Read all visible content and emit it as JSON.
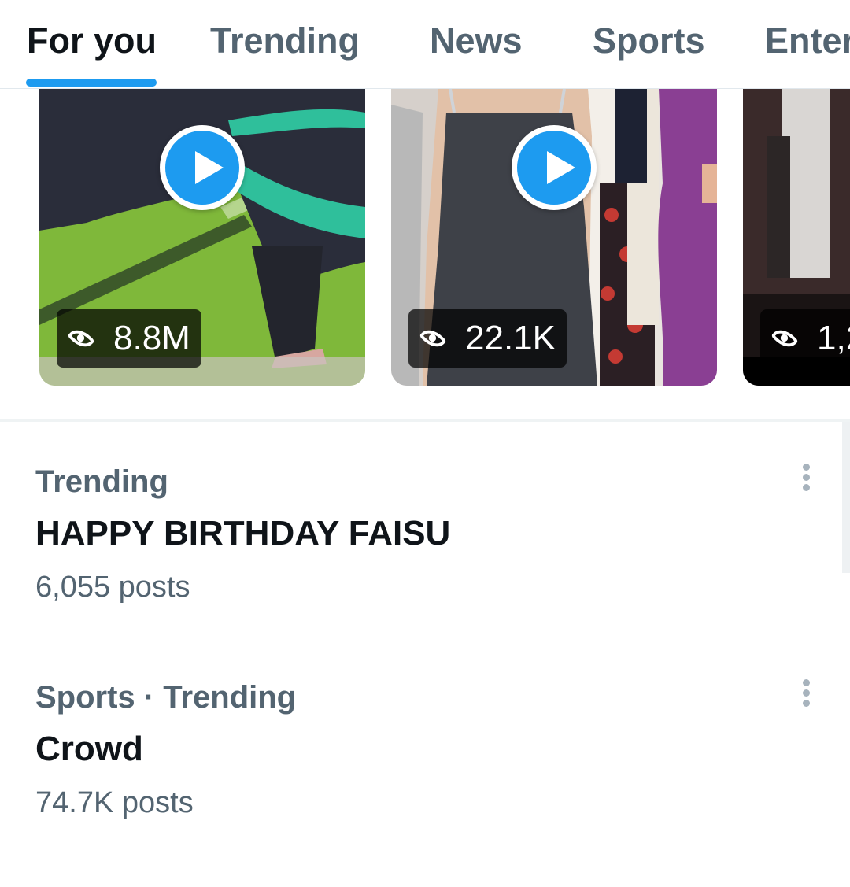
{
  "tabs": [
    {
      "label": "For you",
      "active": true
    },
    {
      "label": "Trending",
      "active": false
    },
    {
      "label": "News",
      "active": false
    },
    {
      "label": "Sports",
      "active": false
    },
    {
      "label": "Enter",
      "active": false
    }
  ],
  "videos": [
    {
      "views": "8.8M",
      "has_play": true
    },
    {
      "views": "22.1K",
      "has_play": true
    },
    {
      "views": "1,2",
      "has_play": false
    }
  ],
  "trends": [
    {
      "context": "Trending",
      "name": "HAPPY BIRTHDAY FAISU",
      "count": "6,055 posts"
    },
    {
      "context": "Sports · Trending",
      "name": "Crowd",
      "count": "74.7K posts"
    }
  ],
  "colors": {
    "accent": "#1d9bf0",
    "secondary_text": "#536471",
    "primary_text": "#0f1419"
  }
}
